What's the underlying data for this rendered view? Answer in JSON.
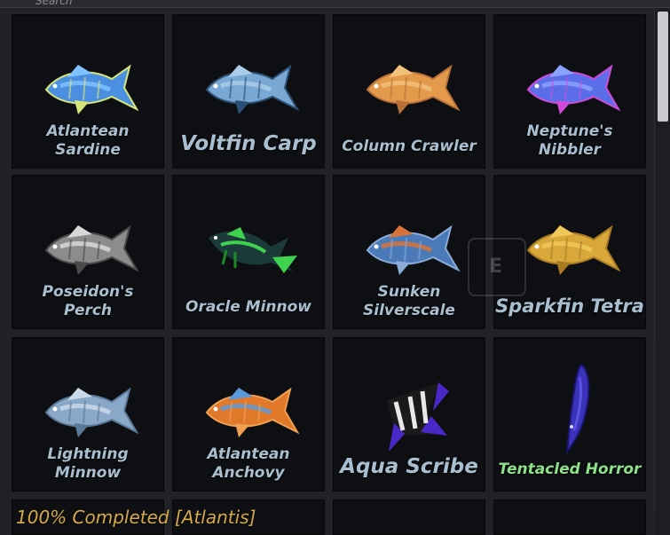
{
  "header": {
    "cut_label": "Search"
  },
  "fish": [
    {
      "name": "Atlantean\nSardine",
      "style": "two",
      "icon": "fish-icon-atlantean-sardine",
      "colors": [
        "#4a8fe0",
        "#7fc2ff",
        "#d8e57a"
      ]
    },
    {
      "name": "Voltfin Carp",
      "style": "big",
      "icon": "fish-icon-voltfin-carp",
      "colors": [
        "#7aa8d4",
        "#a9cde8",
        "#2c4f72"
      ]
    },
    {
      "name": "Column Crawler",
      "style": "one",
      "icon": "fish-icon-column-crawler",
      "colors": [
        "#e39a4a",
        "#f2c27a",
        "#b8703a"
      ]
    },
    {
      "name": "Neptune's\nNibbler",
      "style": "two",
      "icon": "fish-icon-neptunes-nibbler",
      "colors": [
        "#5a6ee8",
        "#8aa2ff",
        "#d04ad8"
      ]
    },
    {
      "name": "Poseidon's\nPerch",
      "style": "two",
      "icon": "fish-icon-poseidons-perch",
      "colors": [
        "#8c8c8c",
        "#d8d8d8",
        "#4a4a4a"
      ]
    },
    {
      "name": "Oracle Minnow",
      "style": "one",
      "icon": "fish-icon-oracle-minnow",
      "colors": [
        "#1a8a2a",
        "#3ed24e",
        "#1c3a3a"
      ]
    },
    {
      "name": "Sunken\nSilverscale",
      "style": "two",
      "icon": "fish-icon-sunken-silverscale",
      "colors": [
        "#4a7ab8",
        "#d8743a",
        "#8aaad8"
      ]
    },
    {
      "name": "Sparkfin Tetra",
      "style": "big-ish",
      "icon": "fish-icon-sparkfin-tetra",
      "colors": [
        "#d8a83a",
        "#f0c85a",
        "#a87a22"
      ]
    },
    {
      "name": "Lightning\nMinnow",
      "style": "two",
      "icon": "fish-icon-lightning-minnow",
      "colors": [
        "#8aa8c8",
        "#c8d8e8",
        "#5a7898"
      ]
    },
    {
      "name": "Atlantean\nAnchovy",
      "style": "two",
      "icon": "fish-icon-atlantean-anchovy",
      "colors": [
        "#e0782a",
        "#5a9ad8",
        "#f0a050"
      ]
    },
    {
      "name": "Aqua Scribe",
      "style": "big",
      "icon": "fish-icon-aqua-scribe",
      "colors": [
        "#4a28c8",
        "#e8e8e8",
        "#1a1a1a"
      ]
    },
    {
      "name": "Tentacled Horror",
      "style": "green",
      "icon": "fish-icon-tentacled-horror",
      "colors": [
        "#3a32b8",
        "#5a52e0",
        "#1a1670"
      ]
    }
  ],
  "prompt": {
    "key": "E"
  },
  "completion": {
    "text": "100% Completed [Atlantis]"
  }
}
